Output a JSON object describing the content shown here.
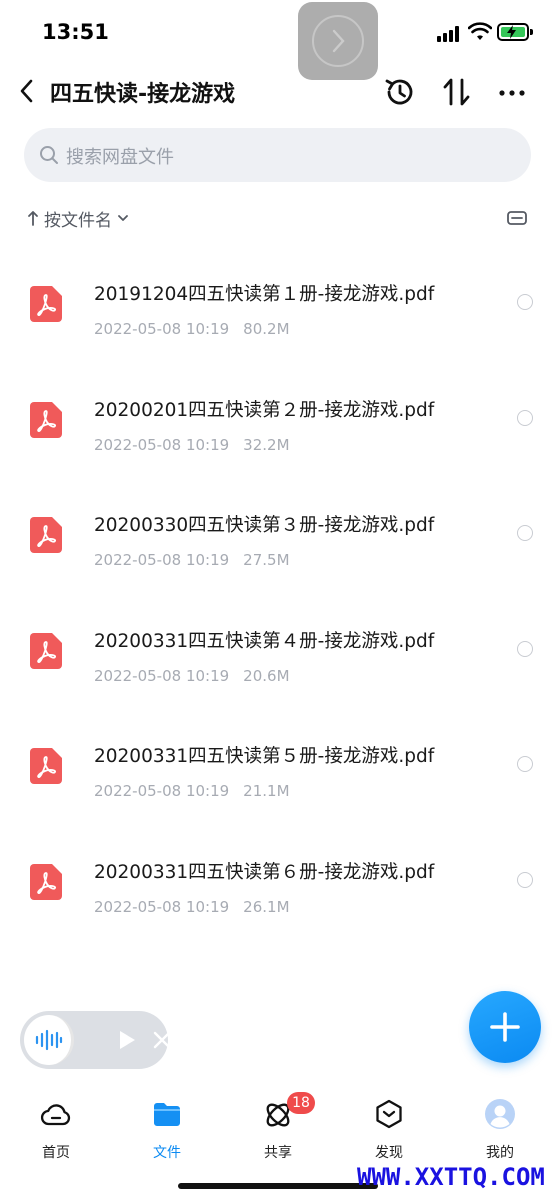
{
  "status_bar": {
    "time": "13:51"
  },
  "header": {
    "title": "四五快读-接龙游戏"
  },
  "search": {
    "placeholder": "搜索网盘文件"
  },
  "sort": {
    "label": "按文件名"
  },
  "files": [
    {
      "name": "20191204四五快读第１册-接龙游戏.pdf",
      "date": "2022-05-08 10:19",
      "size": "80.2M"
    },
    {
      "name": "20200201四五快读第２册-接龙游戏.pdf",
      "date": "2022-05-08 10:19",
      "size": "32.2M"
    },
    {
      "name": "20200330四五快读第３册-接龙游戏.pdf",
      "date": "2022-05-08 10:19",
      "size": "27.5M"
    },
    {
      "name": "20200331四五快读第４册-接龙游戏.pdf",
      "date": "2022-05-08 10:19",
      "size": "20.6M"
    },
    {
      "name": "20200331四五快读第５册-接龙游戏.pdf",
      "date": "2022-05-08 10:19",
      "size": "21.1M"
    },
    {
      "name": "20200331四五快读第６册-接龙游戏.pdf",
      "date": "2022-05-08 10:19",
      "size": "26.1M"
    }
  ],
  "tabs": [
    {
      "label": "首页",
      "icon": "cloud-icon"
    },
    {
      "label": "文件",
      "icon": "folder-icon",
      "active": true
    },
    {
      "label": "共享",
      "icon": "share-orbit-icon",
      "badge": "18"
    },
    {
      "label": "发现",
      "icon": "discover-box-icon"
    },
    {
      "label": "我的",
      "icon": "avatar-icon"
    }
  ],
  "colors": {
    "accent": "#0b8af2",
    "pdf": "#f05a5a",
    "badge": "#ef4b4b"
  },
  "watermark": "WWW.XXTTQ.COM"
}
